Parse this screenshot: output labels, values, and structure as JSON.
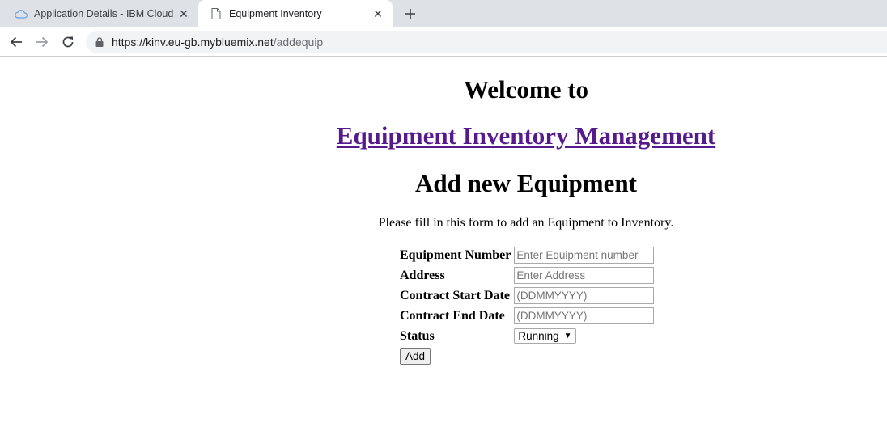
{
  "browser": {
    "tabs": [
      {
        "title": "Application Details - IBM Cloud",
        "active": false,
        "icon": "ibm-cloud-icon"
      },
      {
        "title": "Equipment Inventory",
        "active": true,
        "icon": "page-icon"
      }
    ],
    "url_host": "https://kinv.eu-gb.mybluemix.net",
    "url_path": "/addequip"
  },
  "page": {
    "welcome": "Welcome to",
    "app_link": "Equipment Inventory Management",
    "heading": "Add new Equipment",
    "intro": "Please fill in this form to add an Equipment to Inventory."
  },
  "form": {
    "equipment_number": {
      "label": "Equipment Number",
      "placeholder": "Enter Equipment number",
      "value": ""
    },
    "address": {
      "label": "Address",
      "placeholder": "Enter Address",
      "value": ""
    },
    "contract_start": {
      "label": "Contract Start Date",
      "placeholder": "(DDMMYYYY)",
      "value": ""
    },
    "contract_end": {
      "label": "Contract End Date",
      "placeholder": "(DDMMYYYY)",
      "value": ""
    },
    "status": {
      "label": "Status",
      "selected": "Running"
    },
    "submit_label": "Add"
  },
  "colors": {
    "visited_link": "#551a8b",
    "tabstrip_bg": "#dee1e6",
    "omnibox_bg": "#f1f3f4"
  }
}
